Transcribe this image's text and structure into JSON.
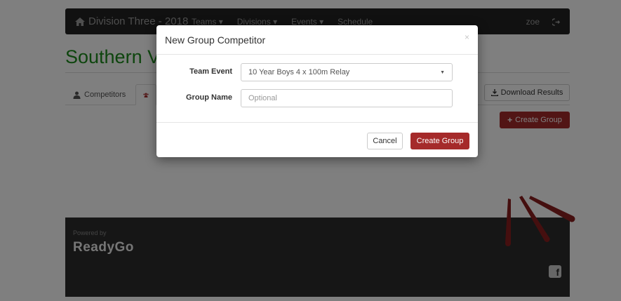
{
  "navbar": {
    "brand": "Division Three - 2018",
    "links": [
      "Teams",
      "Divisions",
      "Events",
      "Schedule"
    ],
    "user": "zoe"
  },
  "page": {
    "title": "Southern V"
  },
  "tabs": [
    {
      "label": "Competitors"
    }
  ],
  "buttons": {
    "download_results": "Download Results",
    "create_group": "Create Group"
  },
  "footer": {
    "powered_by": "Powered by",
    "brand": "ReadyGo"
  },
  "modal": {
    "title": "New Group Competitor",
    "close": "×",
    "fields": {
      "team_event": {
        "label": "Team Event",
        "value": "10 Year Boys 4 x 100m Relay"
      },
      "group_name": {
        "label": "Group Name",
        "placeholder": "Optional"
      }
    },
    "cancel_label": "Cancel",
    "submit_label": "Create Group"
  },
  "colors": {
    "title_green": "#1c8b1c",
    "primary_red": "#a52a2a",
    "navbar": "#222222",
    "footer": "#2d2d2d"
  }
}
